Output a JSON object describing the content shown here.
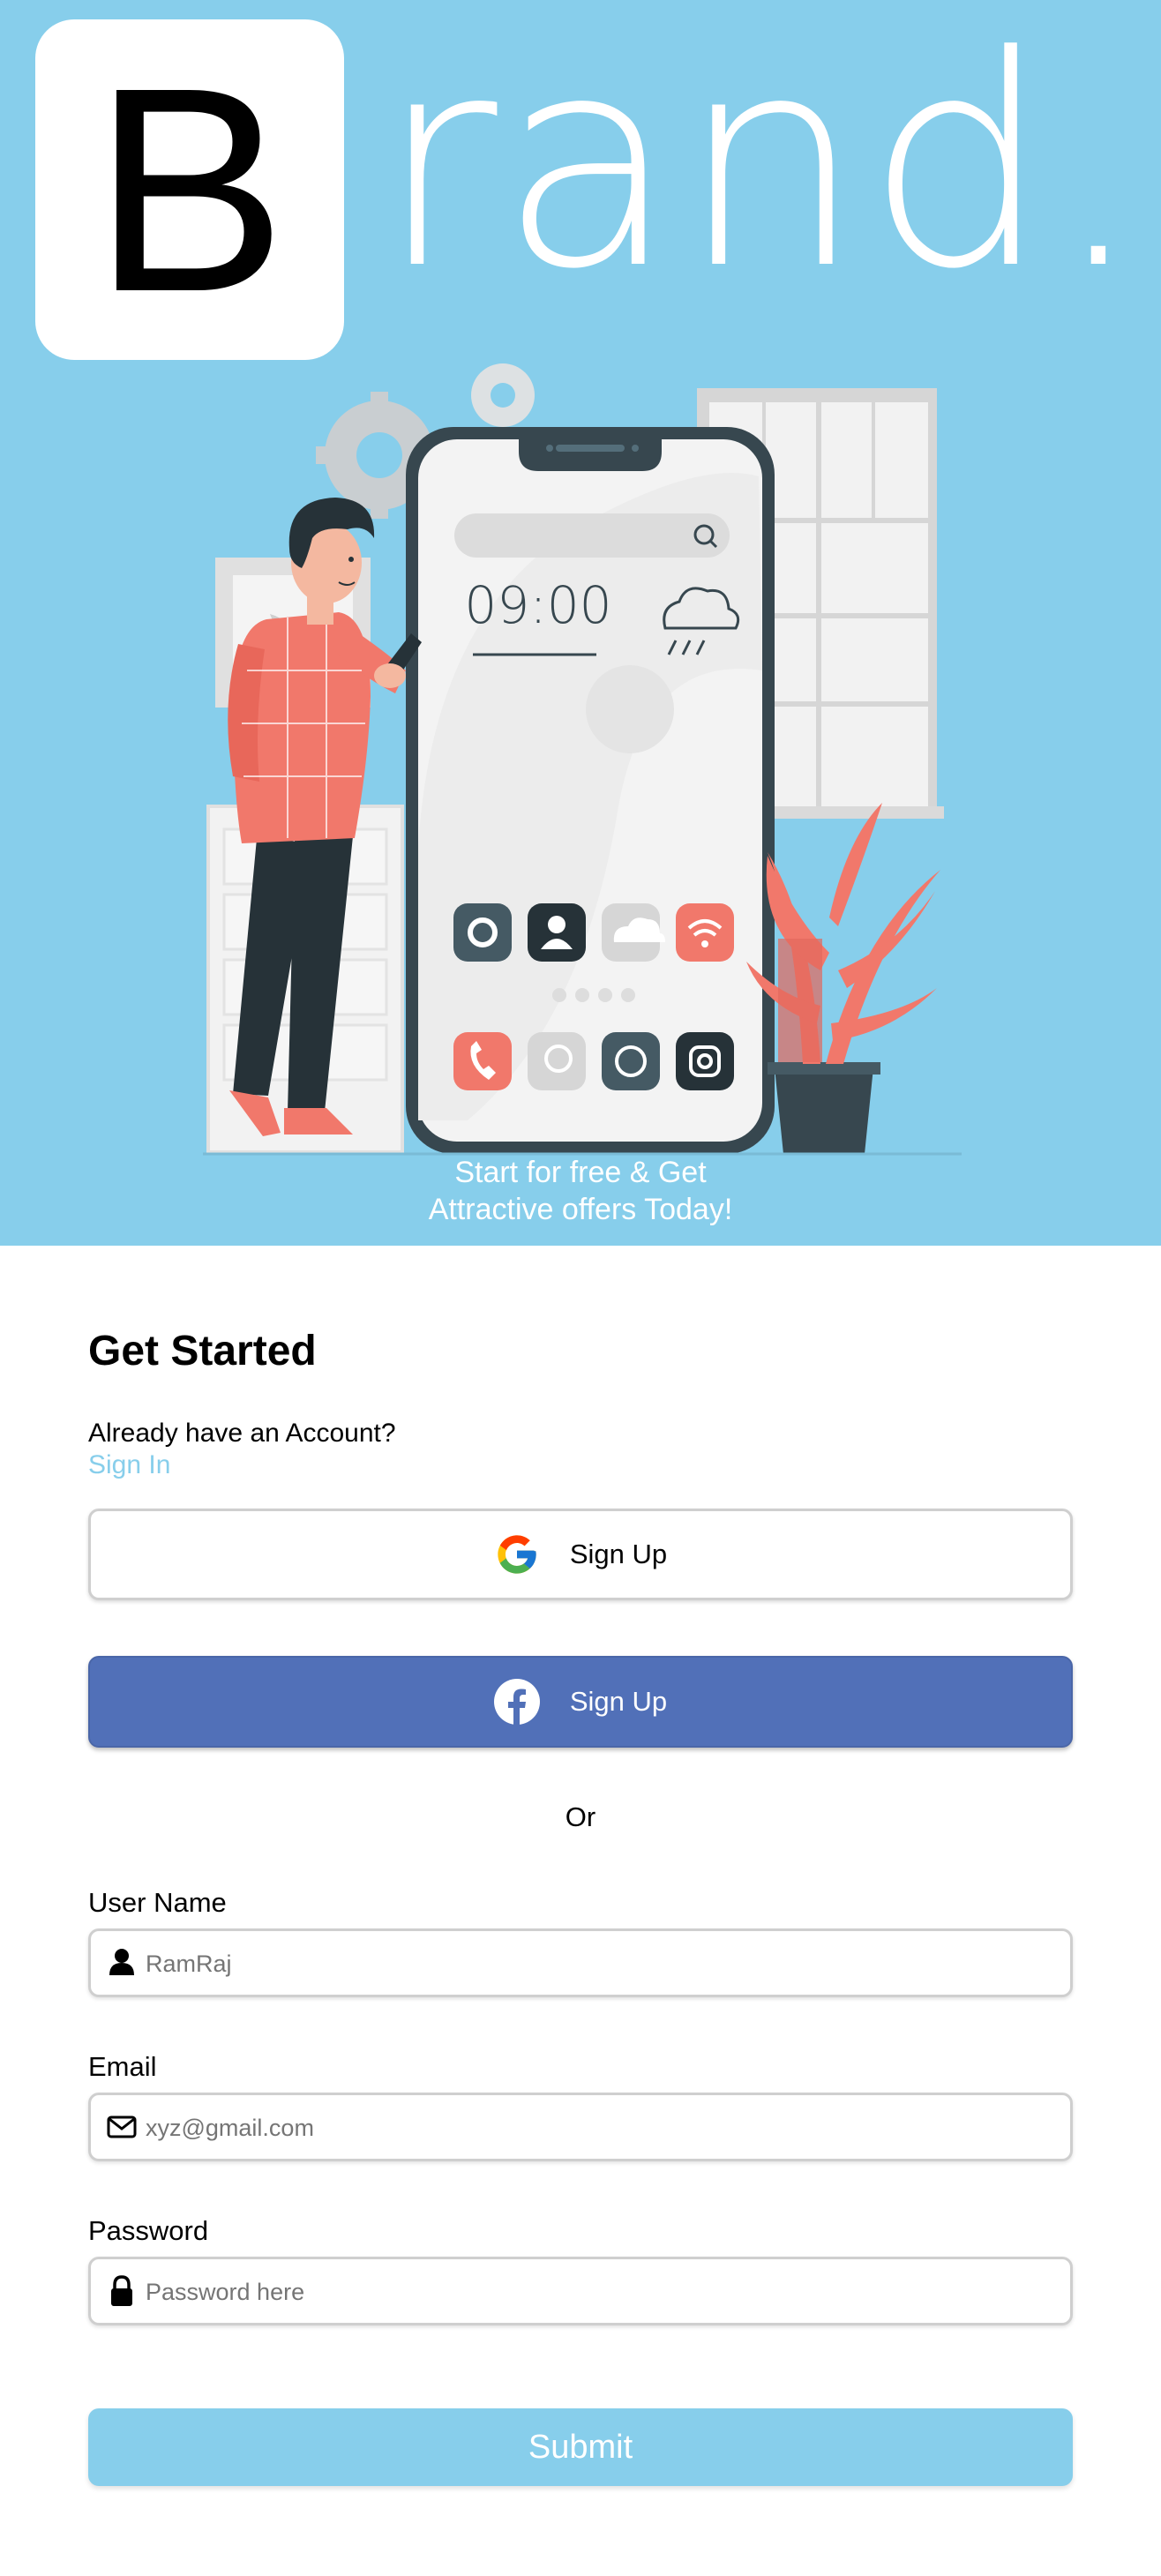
{
  "brand": {
    "logo_letter": "B",
    "logo_rest": "rand."
  },
  "hero": {
    "phone_time": "09:00",
    "tagline_line1": "Start for free & Get",
    "tagline_line2": "Attractive offers Today!"
  },
  "form": {
    "title": "Get Started",
    "already_text": "Already have an Account?",
    "signin_link": "Sign In",
    "google_button_label": "Sign Up",
    "facebook_button_label": "Sign Up",
    "or_text": "Or",
    "username": {
      "label": "User Name",
      "placeholder": "RamRaj"
    },
    "email": {
      "label": "Email",
      "placeholder": "xyz@gmail.com"
    },
    "password": {
      "label": "Password",
      "placeholder": "Password here"
    },
    "submit_label": "Submit"
  },
  "colors": {
    "hero_background": "#87CEEB",
    "facebook_blue": "#5170B8",
    "accent": "#87CEEB",
    "illustration_coral": "#F1786B",
    "illustration_dark": "#37474F"
  },
  "icons": {
    "social": [
      "google-logo-icon",
      "facebook-logo-icon"
    ],
    "fields": [
      "user-icon",
      "envelope-icon",
      "lock-icon"
    ],
    "phone_apps_row1": [
      "gear-icon",
      "contact-icon",
      "cloud-icon",
      "wifi-icon"
    ],
    "phone_apps_row2": [
      "phone-icon",
      "chat-icon",
      "whatsapp-icon",
      "instagram-icon"
    ]
  }
}
